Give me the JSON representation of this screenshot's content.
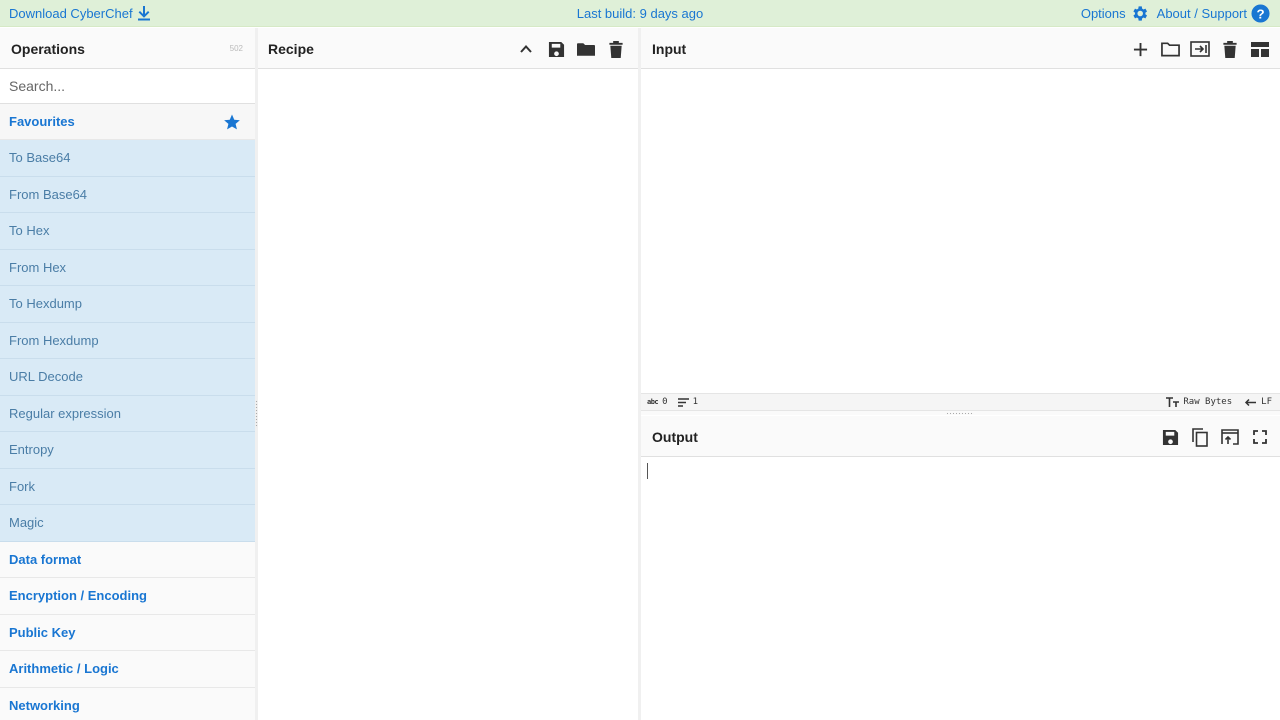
{
  "banner": {
    "download_label": "Download CyberChef",
    "last_build": "Last build: 9 days ago",
    "options_label": "Options",
    "about_label": "About / Support"
  },
  "operations": {
    "title": "Operations",
    "count": "502",
    "search_placeholder": "Search...",
    "favourites_label": "Favourites",
    "favourite_ops": [
      "To Base64",
      "From Base64",
      "To Hex",
      "From Hex",
      "To Hexdump",
      "From Hexdump",
      "URL Decode",
      "Regular expression",
      "Entropy",
      "Fork",
      "Magic"
    ],
    "categories": [
      "Data format",
      "Encryption / Encoding",
      "Public Key",
      "Arithmetic / Logic",
      "Networking"
    ]
  },
  "recipe": {
    "title": "Recipe"
  },
  "input": {
    "title": "Input",
    "value": "",
    "status": {
      "chars_icon_label": "abc",
      "chars": "0",
      "lines": "1",
      "encoding": "Raw Bytes",
      "eol": "LF"
    }
  },
  "output": {
    "title": "Output",
    "value": ""
  },
  "colors": {
    "accent": "#1976d2",
    "banner_bg": "#dff0d8",
    "favourite_bg": "#d9eaf6",
    "favourite_text": "#4a7da6"
  }
}
